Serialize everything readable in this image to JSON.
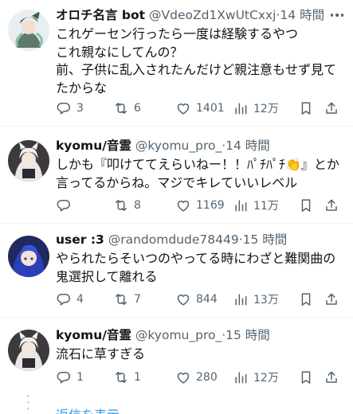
{
  "tweets": [
    {
      "display_name": "オロチ名言 bot",
      "handle": "@VdeoZd1XwUtCxxj",
      "separator": "·",
      "time": "14 時間",
      "text": "これゲーセン行ったら一度は経験するやつ\nこれ親なにしてんの？\n前、子供に乱入されたんだけど親注意もせず見てたからな",
      "reply_count": "3",
      "retweet_count": "6",
      "like_count": "1401",
      "view_count": "12万",
      "avatar_icon": "orochi-character-avatar"
    },
    {
      "display_name": "kyomu/音霊",
      "handle": "@kyomu_pro_",
      "separator": "·",
      "time": "14 時間",
      "text": "しかも『叩けててえらいねー！！ﾊﾟﾁﾊﾟﾁ👏』とか言ってるからね。マジでキレていいレベル",
      "reply_count": "",
      "retweet_count": "8",
      "like_count": "1169",
      "view_count": "11万",
      "avatar_icon": "white-haired-girl-avatar"
    },
    {
      "display_name": "user :3",
      "handle": "@randomdude78449",
      "separator": "·",
      "time": "15 時間",
      "text": "やられたらそいつのやってる時にわざと難関曲の鬼選択して離れる",
      "reply_count": "4",
      "retweet_count": "7",
      "like_count": "844",
      "view_count": "13万",
      "avatar_icon": "blue-haired-anime-avatar"
    },
    {
      "display_name": "kyomu/音霊",
      "handle": "@kyomu_pro_",
      "separator": "·",
      "time": "15 時間",
      "text": "流石に草すぎる",
      "reply_count": "1",
      "retweet_count": "1",
      "like_count": "280",
      "view_count": "12万",
      "avatar_icon": "white-haired-girl-avatar"
    }
  ],
  "show_replies_label": "返信を表示",
  "colors": {
    "text": "#0f1419",
    "muted": "#536471",
    "link": "#1d9bf0",
    "divider": "#eff3f4"
  },
  "icons": [
    "reply-icon",
    "retweet-icon",
    "like-icon",
    "views-icon",
    "bookmark-icon",
    "share-icon",
    "more-icon"
  ]
}
